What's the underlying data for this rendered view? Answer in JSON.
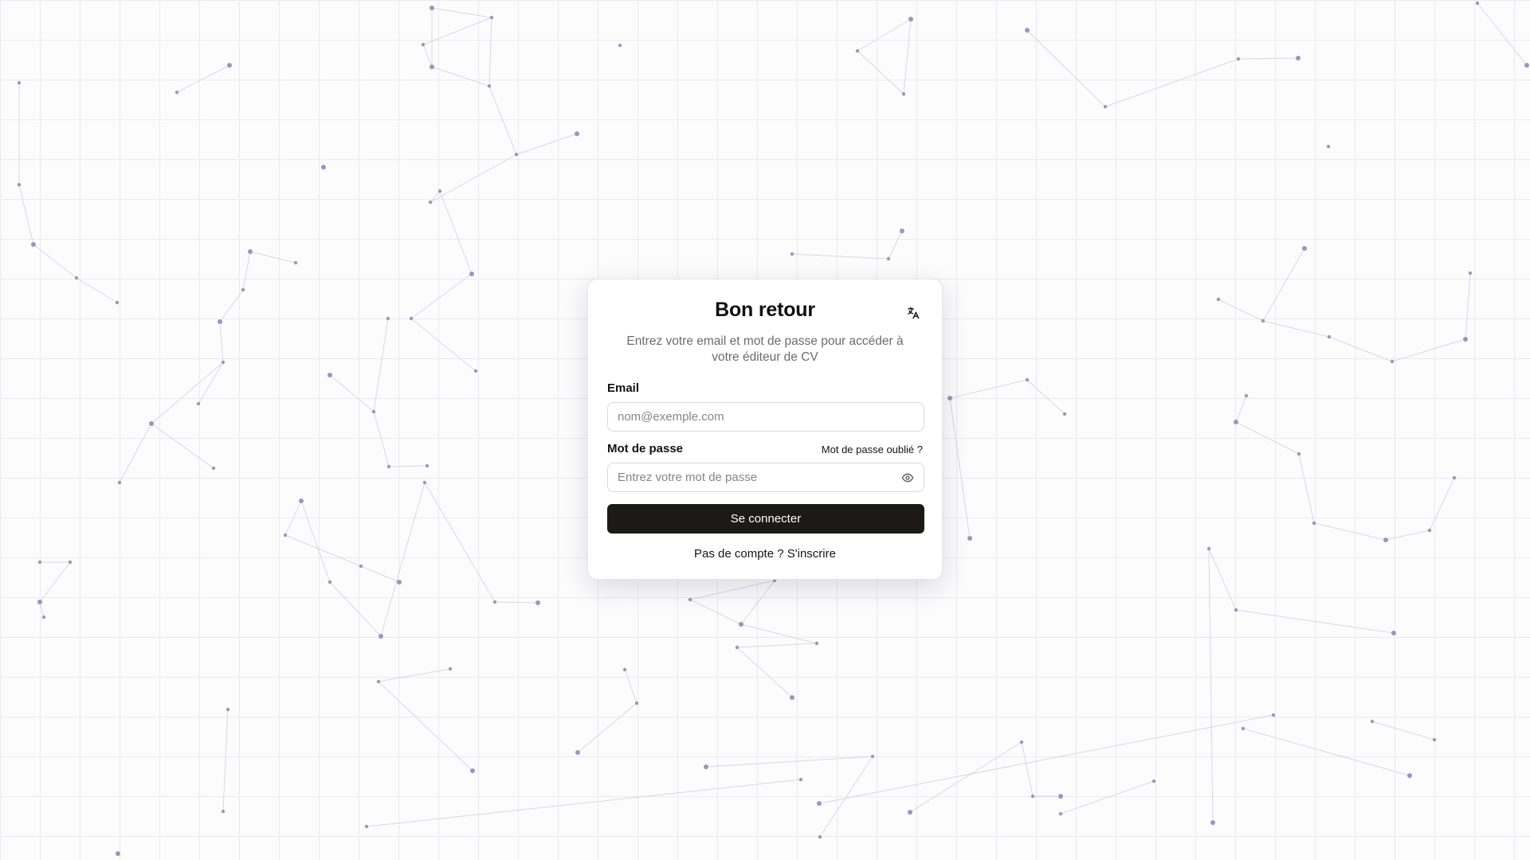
{
  "login_card": {
    "title": "Bon retour",
    "subtitle": "Entrez votre email et mot de passe pour accéder à votre éditeur de CV",
    "email_label": "Email",
    "email_placeholder": "nom@exemple.com",
    "email_value": "",
    "password_label": "Mot de passe",
    "password_placeholder": "Entrez votre mot de passe",
    "password_value": "",
    "forgot_password": "Mot de passe oublié ?",
    "submit_label": "Se connecter",
    "signup_link": "Pas de compte ? S'inscrire",
    "language_icon": "translate-icon",
    "password_toggle_icon": "eye-icon"
  },
  "background": {
    "pattern": "grid with connected network nodes",
    "grid_color": "#ebebef",
    "node_color": "#9a96c0",
    "edge_color": "#c9c8dc"
  },
  "colors": {
    "primary_button": "#1c1917",
    "muted_text": "#6b6b72",
    "border": "#dadade"
  }
}
